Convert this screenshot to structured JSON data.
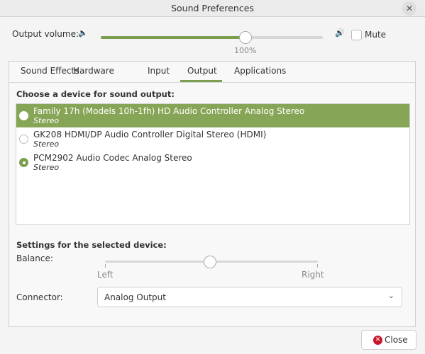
{
  "window": {
    "title": "Sound Preferences"
  },
  "volume": {
    "label": "Output volume:",
    "value_percent": 100,
    "value_label": "100%",
    "mute_label": "Mute",
    "muted": false,
    "accent": "#7c9f4f"
  },
  "tabs": [
    {
      "label": "Sound Effects",
      "active": false
    },
    {
      "label": "Hardware",
      "active": false
    },
    {
      "label": "Input",
      "active": false
    },
    {
      "label": "Output",
      "active": true
    },
    {
      "label": "Applications",
      "active": false
    }
  ],
  "output": {
    "heading": "Choose a device for sound output:",
    "devices": [
      {
        "name": "Family 17h (Models 10h-1fh) HD Audio Controller Analog Stereo",
        "profile": "Stereo",
        "highlighted": true,
        "checked": false
      },
      {
        "name": "GK208 HDMI/DP Audio Controller Digital Stereo (HDMI)",
        "profile": "Stereo",
        "highlighted": false,
        "checked": false
      },
      {
        "name": "PCM2902 Audio Codec Analog Stereo",
        "profile": "Stereo",
        "highlighted": false,
        "checked": true
      }
    ],
    "settings_heading": "Settings for the selected device:",
    "balance_label": "Balance:",
    "balance_left": "Left",
    "balance_right": "Right",
    "balance_value": 0,
    "connector_label": "Connector:",
    "connector_value": "Analog Output"
  },
  "footer": {
    "close_label": "Close"
  }
}
